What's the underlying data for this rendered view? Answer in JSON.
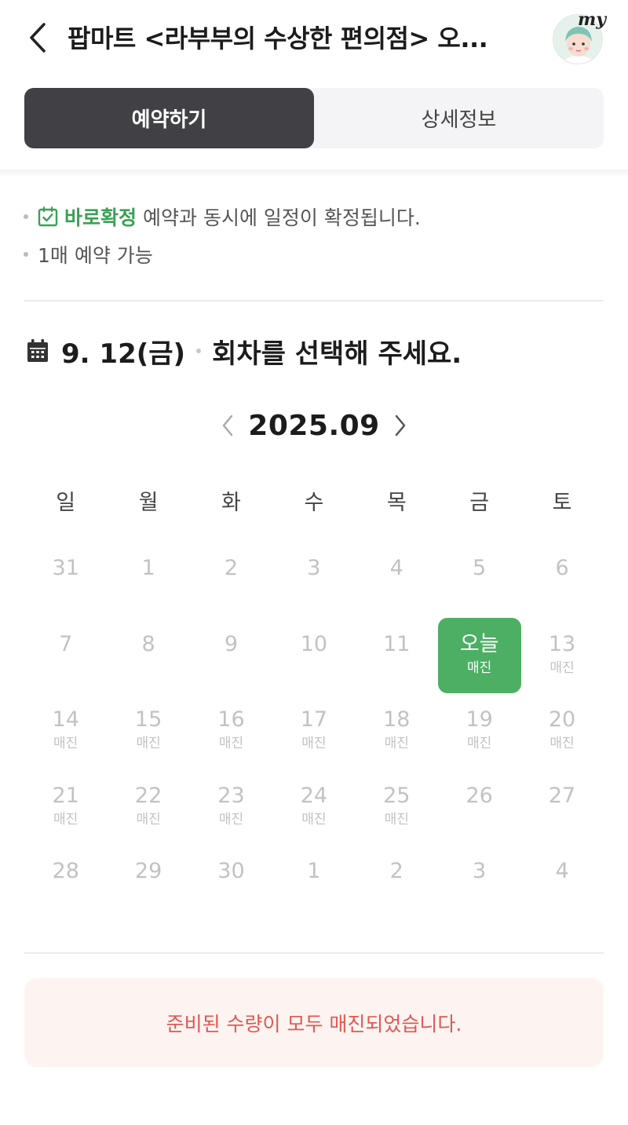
{
  "header": {
    "title": "팝마트 <라부부의 수상한 편의점> 오...",
    "my_label": "my"
  },
  "tabs": [
    {
      "label": "예약하기",
      "active": true
    },
    {
      "label": "상세정보",
      "active": false
    }
  ],
  "info": {
    "confirm_label": "바로확정",
    "confirm_text": "예약과 동시에 일정이 확정됩니다.",
    "limit_text": "1매 예약 가능"
  },
  "selection": {
    "date": "9. 12(금)",
    "prompt": "회차를 선택해 주세요."
  },
  "calendar": {
    "month": "2025.09",
    "weekdays": [
      "일",
      "월",
      "화",
      "수",
      "목",
      "금",
      "토"
    ],
    "weeks": [
      [
        {
          "num": "31",
          "sub": ""
        },
        {
          "num": "1",
          "sub": ""
        },
        {
          "num": "2",
          "sub": ""
        },
        {
          "num": "3",
          "sub": ""
        },
        {
          "num": "4",
          "sub": ""
        },
        {
          "num": "5",
          "sub": ""
        },
        {
          "num": "6",
          "sub": ""
        }
      ],
      [
        {
          "num": "7",
          "sub": ""
        },
        {
          "num": "8",
          "sub": ""
        },
        {
          "num": "9",
          "sub": ""
        },
        {
          "num": "10",
          "sub": ""
        },
        {
          "num": "11",
          "sub": ""
        },
        {
          "num": "오늘",
          "sub": "매진",
          "today": true
        },
        {
          "num": "13",
          "sub": "매진"
        }
      ],
      [
        {
          "num": "14",
          "sub": "매진"
        },
        {
          "num": "15",
          "sub": "매진"
        },
        {
          "num": "16",
          "sub": "매진"
        },
        {
          "num": "17",
          "sub": "매진"
        },
        {
          "num": "18",
          "sub": "매진"
        },
        {
          "num": "19",
          "sub": "매진"
        },
        {
          "num": "20",
          "sub": "매진"
        }
      ],
      [
        {
          "num": "21",
          "sub": "매진"
        },
        {
          "num": "22",
          "sub": "매진"
        },
        {
          "num": "23",
          "sub": "매진"
        },
        {
          "num": "24",
          "sub": "매진"
        },
        {
          "num": "25",
          "sub": "매진"
        },
        {
          "num": "26",
          "sub": ""
        },
        {
          "num": "27",
          "sub": ""
        }
      ],
      [
        {
          "num": "28",
          "sub": ""
        },
        {
          "num": "29",
          "sub": ""
        },
        {
          "num": "30",
          "sub": ""
        },
        {
          "num": "1",
          "sub": ""
        },
        {
          "num": "2",
          "sub": ""
        },
        {
          "num": "3",
          "sub": ""
        },
        {
          "num": "4",
          "sub": ""
        }
      ]
    ]
  },
  "notice": {
    "text": "준비된 수량이 모두 매진되었습니다."
  },
  "colors": {
    "accent_green": "#4caf63",
    "active_tab": "#404045",
    "notice_text": "#e0584f",
    "notice_bg": "#fdf4f2"
  }
}
